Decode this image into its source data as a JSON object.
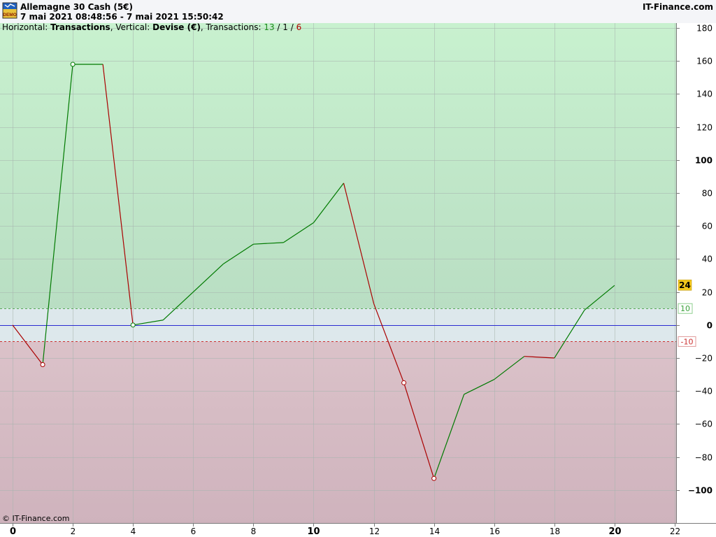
{
  "header": {
    "title": "Allemagne 30 Cash (5€)",
    "date_range": "7 mai 2021 08:48:56 - 7 mai 2021 15:50:42",
    "brand": "IT-Finance.com",
    "logo_text": "DEMO"
  },
  "info": {
    "h_label": "Horizontal: ",
    "h_value": "Transactions",
    "v_label": ", Vertical: ",
    "v_value": "Devise (€)",
    "t_label": ", Transactions: ",
    "wins": "13",
    "sep1": " / ",
    "flat": "1",
    "sep2": " / ",
    "losses": "6"
  },
  "copyright": "© IT-Finance.com",
  "colors": {
    "profit_zone": "#c8efcf",
    "loss_zone": "#d8bcc5",
    "neutral_zone": "#dde8ec",
    "up_line": "#007a00",
    "down_line": "#aa0000",
    "zero_line": "#2a2ad0",
    "current_badge": "#f3c81e"
  },
  "chart_data": {
    "type": "line",
    "xlabel": "",
    "ylabel": "",
    "xlim": [
      0,
      22
    ],
    "ylim": [
      -120,
      183
    ],
    "x_ticks": [
      0,
      2,
      4,
      6,
      8,
      10,
      12,
      14,
      16,
      18,
      20,
      22
    ],
    "x_bold_ticks": [
      0,
      10,
      20
    ],
    "y_ticks": [
      180,
      160,
      140,
      120,
      100,
      80,
      60,
      40,
      20,
      0,
      -20,
      -40,
      -60,
      -80,
      -100
    ],
    "y_bold_ticks": [
      100,
      0,
      -100
    ],
    "thresholds": {
      "upper": 10,
      "lower": -10,
      "upper_label": "10",
      "lower_label": "-10"
    },
    "current_value": 24,
    "current_label": "24",
    "x": [
      0,
      1,
      2,
      3,
      4,
      5,
      6,
      7,
      8,
      9,
      10,
      11,
      12,
      13,
      14,
      15,
      16,
      17,
      18,
      19,
      20
    ],
    "y": [
      0,
      -24,
      158,
      158,
      0,
      3,
      20,
      37,
      49,
      50,
      62,
      86,
      13,
      -35,
      -93,
      -42,
      -33,
      -19,
      -20,
      9,
      24
    ],
    "markers": [
      {
        "x": 1,
        "y": -24
      },
      {
        "x": 2,
        "y": 158
      },
      {
        "x": 4,
        "y": 0
      },
      {
        "x": 13,
        "y": -35
      },
      {
        "x": 14,
        "y": -93
      }
    ],
    "grid": true
  }
}
